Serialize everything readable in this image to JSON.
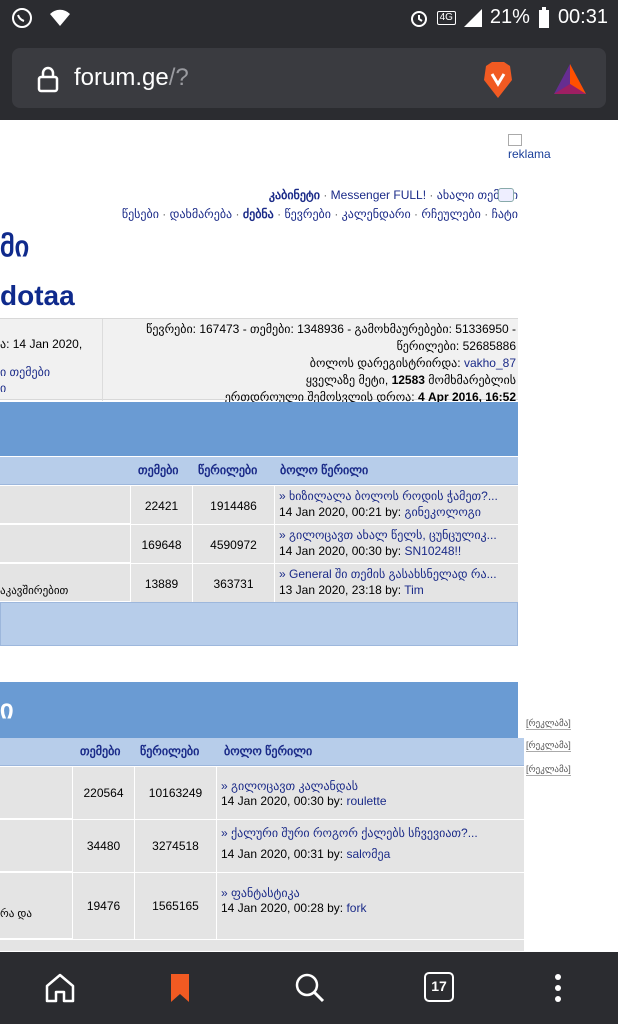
{
  "status_bar": {
    "battery": "21%",
    "time": "00:31",
    "network": "4G"
  },
  "browser": {
    "url_host": "forum.ge",
    "url_path": "/?"
  },
  "ad": {
    "top_label": "reklama",
    "side_labels": [
      "[რეკლამა]",
      "[რეკლამა]",
      "[რეკლამა]"
    ]
  },
  "top_links_row1": {
    "cabinet": "კაბინეტი",
    "messenger": "Messenger FULL!",
    "new_topics": "ახალი თემები"
  },
  "top_links_row2": {
    "rules": "წესები",
    "help": "დახმარება",
    "search": "ძებნა",
    "members": "წევრები",
    "calendar": "კალენდარი",
    "favorites": "რჩეულები",
    "chat": "ჩატი"
  },
  "titles": {
    "t1": "მი",
    "t2": "dotaa"
  },
  "stats": {
    "left_line1": "ა: 14 Jan 2020,",
    "left_line2": "ი თემები",
    "left_line3": "ი",
    "line1": "წევრები: 167473 - თემები: 1348936 - გამოხმაურებები: 51336950 -",
    "line2": "წერილები: 52685886",
    "line3_prefix": "ბოლოს დარეგისტრირდა:",
    "line3_user": "vakho_87",
    "line4_prefix": "ყველაზე მეტი,",
    "line4_bold": "12583",
    "line4_suffix": "მომხმარებლის",
    "line5_prefix": "ერთდროული შემოსვლის დროა:",
    "line5_bold": "4 Apr 2016, 16:52"
  },
  "table1": {
    "headers": {
      "topics": "თემები",
      "posts": "წერილები",
      "last": "ბოლო წერილი"
    },
    "rows": [
      {
        "topics": "22421",
        "posts": "1914486",
        "title": "ხიზილალა ბოლოს როდის ჭამეთ?...",
        "date": "14 Jan 2020, 00:21",
        "by": "by:",
        "user": "გინეკოლოგი",
        "left": ""
      },
      {
        "topics": "169648",
        "posts": "4590972",
        "title": "გილოცავთ ახალ წელს, ცუნცულიკ...",
        "date": "14 Jan 2020, 00:30",
        "by": "by:",
        "user": "SN10248!!",
        "left": ""
      },
      {
        "topics": "13889",
        "posts": "363731",
        "title": "General ში თემის გასახსნელად რა...",
        "date": "13 Jan 2020, 23:18",
        "by": "by:",
        "user": "Tim",
        "left": "აკავშირებით"
      }
    ]
  },
  "table2": {
    "category_title": "ი",
    "headers": {
      "topics": "თემები",
      "posts": "წერილები",
      "last": "ბოლო წერილი"
    },
    "rows": [
      {
        "topics": "220564",
        "posts": "10163249",
        "title": "გილოცავთ კალანდას",
        "date": "14 Jan 2020, 00:30",
        "by": "by:",
        "user": "roulette",
        "left": ""
      },
      {
        "topics": "34480",
        "posts": "3274518",
        "title": "ქალური შური როგორ ქალებს სჩვევიათ?...",
        "date": "14 Jan 2020, 00:31",
        "by": "by:",
        "user": "salომეa",
        "left": ""
      },
      {
        "topics": "19476",
        "posts": "1565165",
        "title": "ფანტასტიკა",
        "date": "14 Jan 2020, 00:28",
        "by": "by:",
        "user": "fork",
        "left": "რა და"
      }
    ]
  },
  "bottom_nav": {
    "tab_count": "17"
  }
}
